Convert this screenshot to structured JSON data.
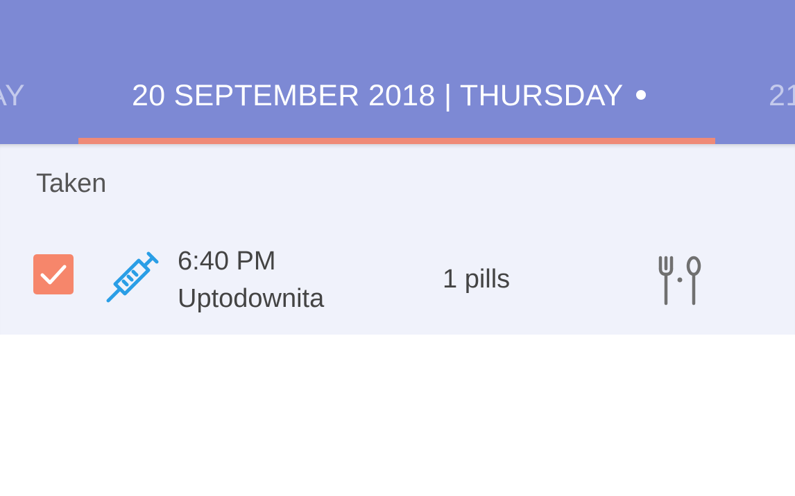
{
  "header": {
    "prev_tab": "AY",
    "current_tab": "20 SEPTEMBER 2018 | THURSDAY",
    "next_tab": "21",
    "background_color": "#7d89d4",
    "indicator_color": "#ef8a77"
  },
  "section": {
    "label": "Taken",
    "background_color": "#f0f2fb"
  },
  "medication": {
    "time": "6:40 PM",
    "name": "Uptodownita",
    "dosage": "1 pills",
    "checked": true,
    "type_icon": "syringe-icon",
    "meal_icon": "fork-spoon-icon",
    "checkbox_color": "#f6866b",
    "icon_color": "#2a9ee6"
  }
}
